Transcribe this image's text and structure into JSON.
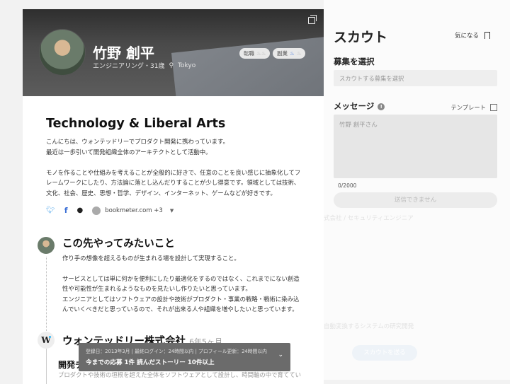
{
  "profile": {
    "name": "竹野 創平",
    "subtitle": "エンジニアリング・31歳",
    "location": "Tokyo",
    "badges": [
      {
        "label": "転職"
      },
      {
        "label": "副業"
      }
    ],
    "headline": "Technology & Liberal Arts",
    "intro": [
      "こんにちは、ウォンテッドリーでプロダクト開発に携わっています。",
      "最近は一歩引いて開発組織全体のアーキテクトとして活動中。",
      "モノを作ることや仕組みを考えることが全般的に好きで、任意のことを良い感じに抽象化してフ",
      "レームワークにしたり、方法論に落とし込んだりすることが少し得意です。領域としては技術、",
      "文化、社会、歴史、思想・哲学、デザイン、インターネット、ゲームなどが好きです。"
    ],
    "links": {
      "website": "bookmeter.com +3"
    }
  },
  "future": {
    "heading": "この先やってみたいこと",
    "lines": [
      "作り手の想像を超えるものが生まれる場を設計して実現すること。",
      "サービスとしては単に何かを便利にしたり最適化をするのではなく、これまでにない創造",
      "性や可能性が生まれるようなものを見たいし作りたいと思っています。",
      "エンジニアとしてはソフトウェアの設計や技術がプロダクト・事業の戦略・戦術に染み込",
      "んでいくべきだと思っているので、それが出来る人や組織を増やしたいと思っています。"
    ]
  },
  "experience": {
    "company": "ウォンテッドリー株式会社",
    "duration": "6年5ヶ月",
    "team": "開発チ",
    "desc": "プロダクトや技術の垣根を超えた全体をソフトウェアとして設計し、時間軸の中で育ててい"
  },
  "toast": {
    "meta": "登録日：2013年3月 | 最終ログイン：24時間以内 | プロフィール更新：24時間以内",
    "stats": "今までの応募 1件  読んだストーリー 10件以上"
  },
  "scout": {
    "title": "スカウト",
    "watch_label": "気になる",
    "recruit_label": "募集を選択",
    "recruit_placeholder": "スカウトする募集を選択",
    "message_label": "メッセージ",
    "template_label": "テンプレート",
    "message_value": "竹野 創平さん",
    "char_count": "0/2000",
    "send_label": "送信できません",
    "send_scout_label": "スカウトを送る"
  }
}
